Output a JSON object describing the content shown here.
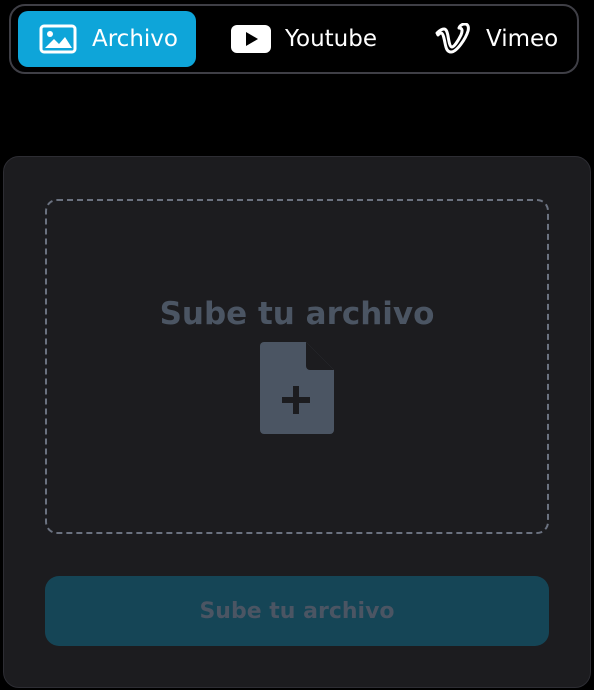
{
  "tabs": [
    {
      "label": "Archivo",
      "icon": "image-icon",
      "active": true
    },
    {
      "label": "Youtube",
      "icon": "youtube-icon",
      "active": false
    },
    {
      "label": "Vimeo",
      "icon": "vimeo-icon",
      "active": false
    }
  ],
  "upload": {
    "dropzone_title": "Sube tu archivo",
    "dropzone_icon": "file-plus-icon",
    "button_label": "Sube tu archivo"
  },
  "colors": {
    "accent": "#0ea5d9",
    "background": "#000000",
    "card": "#1c1c1f",
    "muted_text": "#4b5563",
    "button_disabled": "#154556"
  }
}
